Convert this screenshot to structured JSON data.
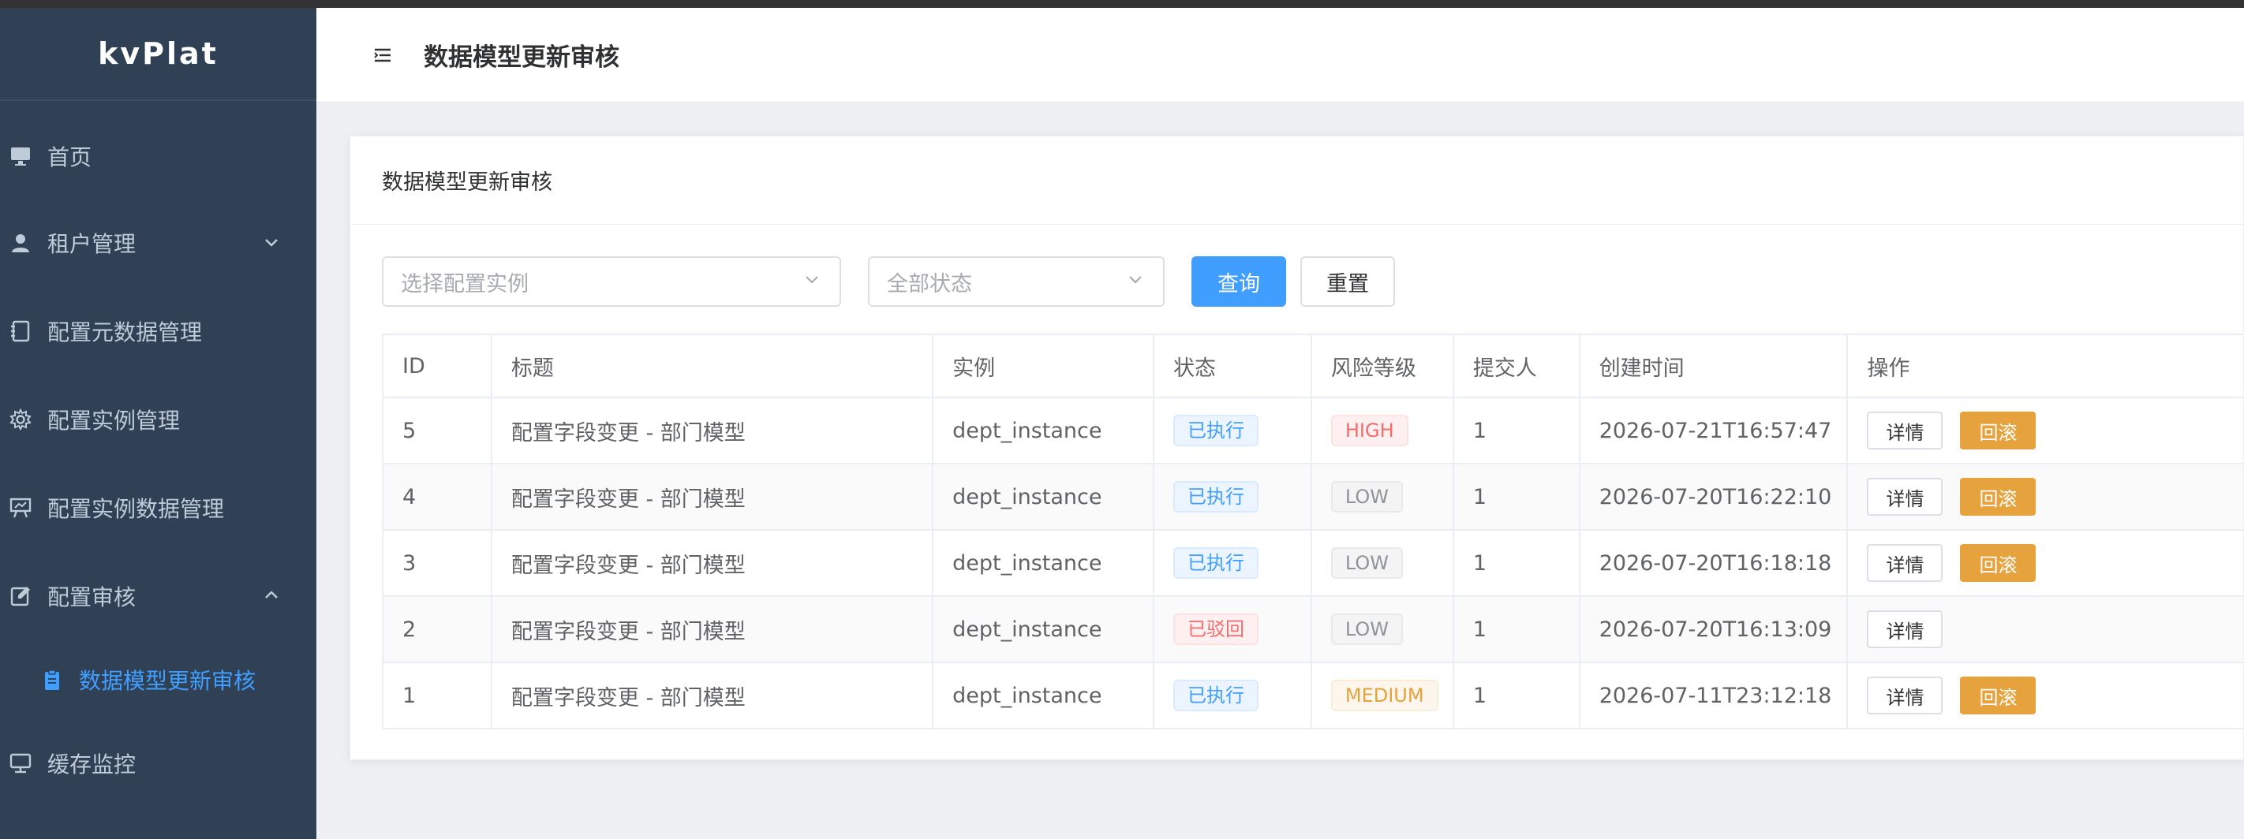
{
  "app": {
    "name": "kvPlat"
  },
  "sidebar": {
    "items": [
      {
        "label": "首页",
        "icon": "monitor-icon"
      },
      {
        "label": "租户管理",
        "icon": "user-icon",
        "expandable": true
      },
      {
        "label": "配置元数据管理",
        "icon": "notebook-icon"
      },
      {
        "label": "配置实例管理",
        "icon": "gear-icon"
      },
      {
        "label": "配置实例数据管理",
        "icon": "presentation-icon"
      },
      {
        "label": "配置审核",
        "icon": "edit-icon",
        "expanded": true
      },
      {
        "label": "数据模型更新审核",
        "icon": "clipboard-icon",
        "active": true
      },
      {
        "label": "缓存监控",
        "icon": "monitor-icon"
      }
    ]
  },
  "navbar": {
    "title": "数据模型更新审核"
  },
  "card": {
    "title": "数据模型更新审核"
  },
  "filters": {
    "instance_placeholder": "选择配置实例",
    "status_placeholder": "全部状态",
    "query_label": "查询",
    "reset_label": "重置"
  },
  "table": {
    "columns": [
      "ID",
      "标题",
      "实例",
      "状态",
      "风险等级",
      "提交人",
      "创建时间",
      "操作"
    ],
    "rows": [
      {
        "id": "5",
        "title": "配置字段变更 - 部门模型",
        "instance": "dept_instance",
        "status": "已执行",
        "risk": "HIGH",
        "submitter": "1",
        "created": "2026-07-21T16:57:47",
        "rollback": true
      },
      {
        "id": "4",
        "title": "配置字段变更 - 部门模型",
        "instance": "dept_instance",
        "status": "已执行",
        "risk": "LOW",
        "submitter": "1",
        "created": "2026-07-20T16:22:10",
        "rollback": true
      },
      {
        "id": "3",
        "title": "配置字段变更 - 部门模型",
        "instance": "dept_instance",
        "status": "已执行",
        "risk": "LOW",
        "submitter": "1",
        "created": "2026-07-20T16:18:18",
        "rollback": true
      },
      {
        "id": "2",
        "title": "配置字段变更 - 部门模型",
        "instance": "dept_instance",
        "status": "已驳回",
        "risk": "LOW",
        "submitter": "1",
        "created": "2026-07-20T16:13:09",
        "rollback": false
      },
      {
        "id": "1",
        "title": "配置字段变更 - 部门模型",
        "instance": "dept_instance",
        "status": "已执行",
        "risk": "MEDIUM",
        "submitter": "1",
        "created": "2026-07-11T23:12:18",
        "rollback": true
      }
    ],
    "detail_label": "详情",
    "rollback_label": "回滚"
  },
  "colors": {
    "sidebar_bg": "#304156",
    "accent": "#409eff",
    "warning": "#e6a23c",
    "danger": "#f56c6c"
  }
}
